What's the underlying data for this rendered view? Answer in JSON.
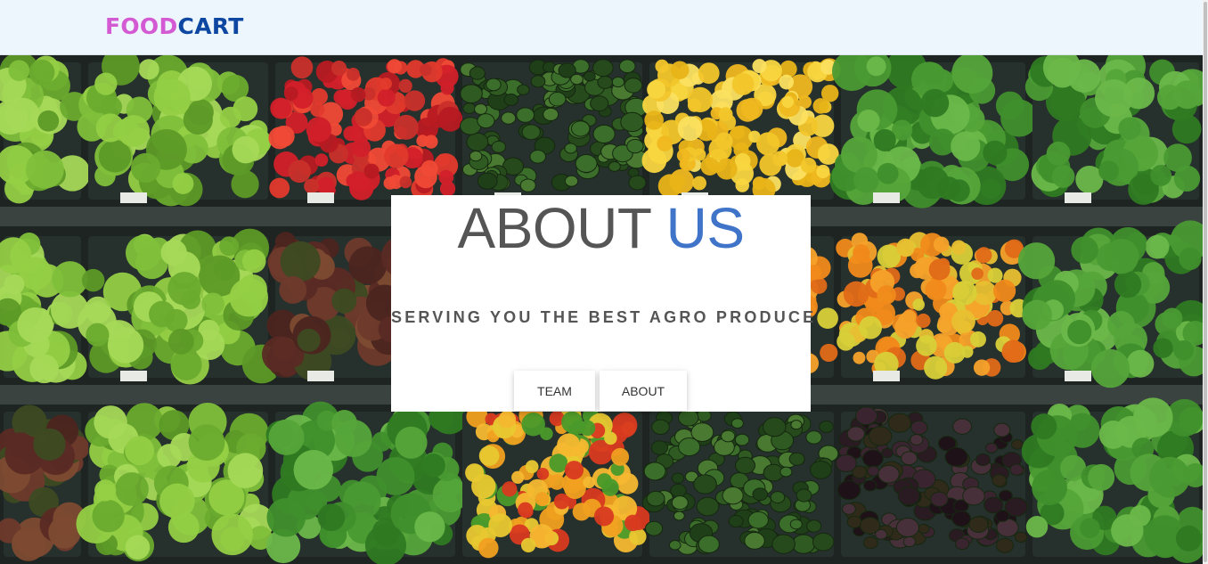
{
  "navbar": {
    "brand_part1": "FOOD",
    "brand_part2": "CART"
  },
  "hero": {
    "title_part1": "ABOUT ",
    "title_part2": "US",
    "tagline": "SERVING YOU THE BEST AGRO PRODUCE",
    "buttons": {
      "team": "TEAM",
      "about": "ABOUT"
    }
  },
  "colors": {
    "brand_food": "#d35ad3",
    "brand_cart": "#0d47a1",
    "title_accent": "#3f74c9",
    "title_text": "#555555",
    "navbar_bg": "#eef6fd"
  }
}
